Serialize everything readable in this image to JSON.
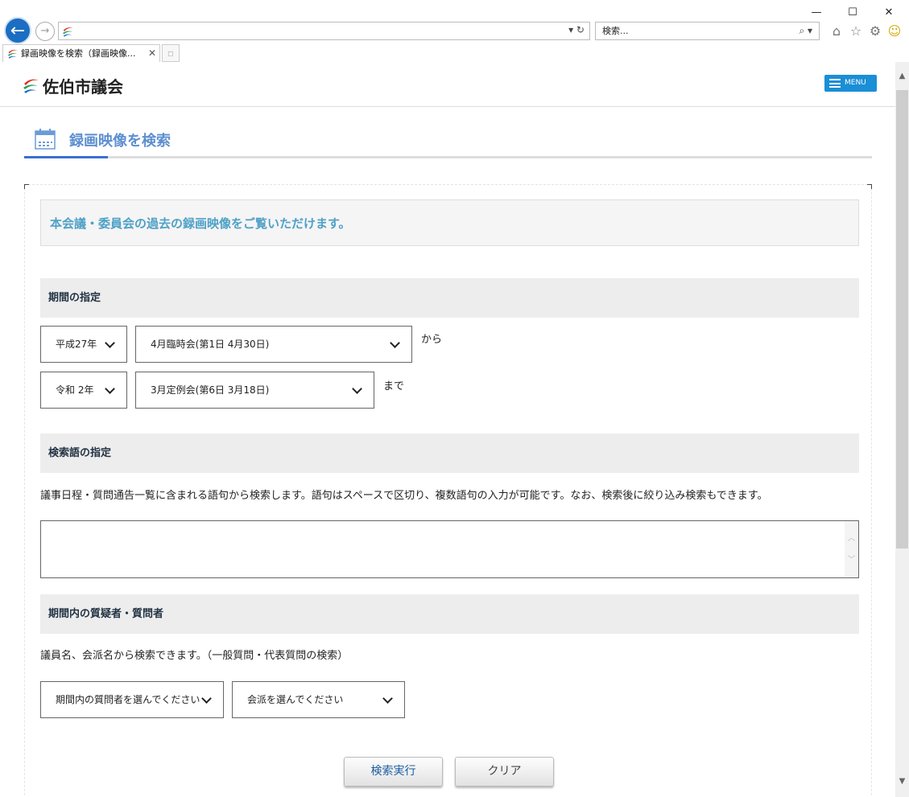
{
  "window": {
    "minimize": "—",
    "maximize": "☐",
    "close": "✕"
  },
  "browser": {
    "back_icon": "←",
    "forward_icon": "→",
    "address_value": "",
    "address_controls": "▾ ↻",
    "search_placeholder": "検索...",
    "search_controls": "⌕ ▾",
    "tab_title": "録画映像を検索（録画映像...",
    "tab_close": "✕"
  },
  "header": {
    "site_name": "佐伯市議会",
    "menu_label": "MENU"
  },
  "page": {
    "title": "録画映像を検索",
    "intro": "本会議・委員会の過去の録画映像をご覧いただけます。"
  },
  "period": {
    "heading": "期間の指定",
    "from_year": "平成27年",
    "from_session": "4月臨時会(第1日 4月30日)",
    "from_label": "から",
    "to_year": "令和 2年",
    "to_session": "3月定例会(第6日 3月18日)",
    "to_label": "まで"
  },
  "keyword": {
    "heading": "検索語の指定",
    "description": "議事日程・質問通告一覧に含まれる語句から検索します。語句はスペースで区切り、複数語句の入力が可能です。なお、検索後に絞り込み検索もできます。",
    "value": ""
  },
  "questioner": {
    "heading": "期間内の質疑者・質問者",
    "description": "議員名、会派名から検索できます。（一般質問・代表質問の検索）",
    "member_select": "期間内の質問者を選んでください",
    "faction_select": "会派を選んでください"
  },
  "actions": {
    "search": "検索実行",
    "clear": "クリア"
  },
  "colors": {
    "accent": "#1a8ed6",
    "title": "#5d8fcf",
    "intro": "#4fa0c7",
    "underline": "#3a6fd0"
  }
}
